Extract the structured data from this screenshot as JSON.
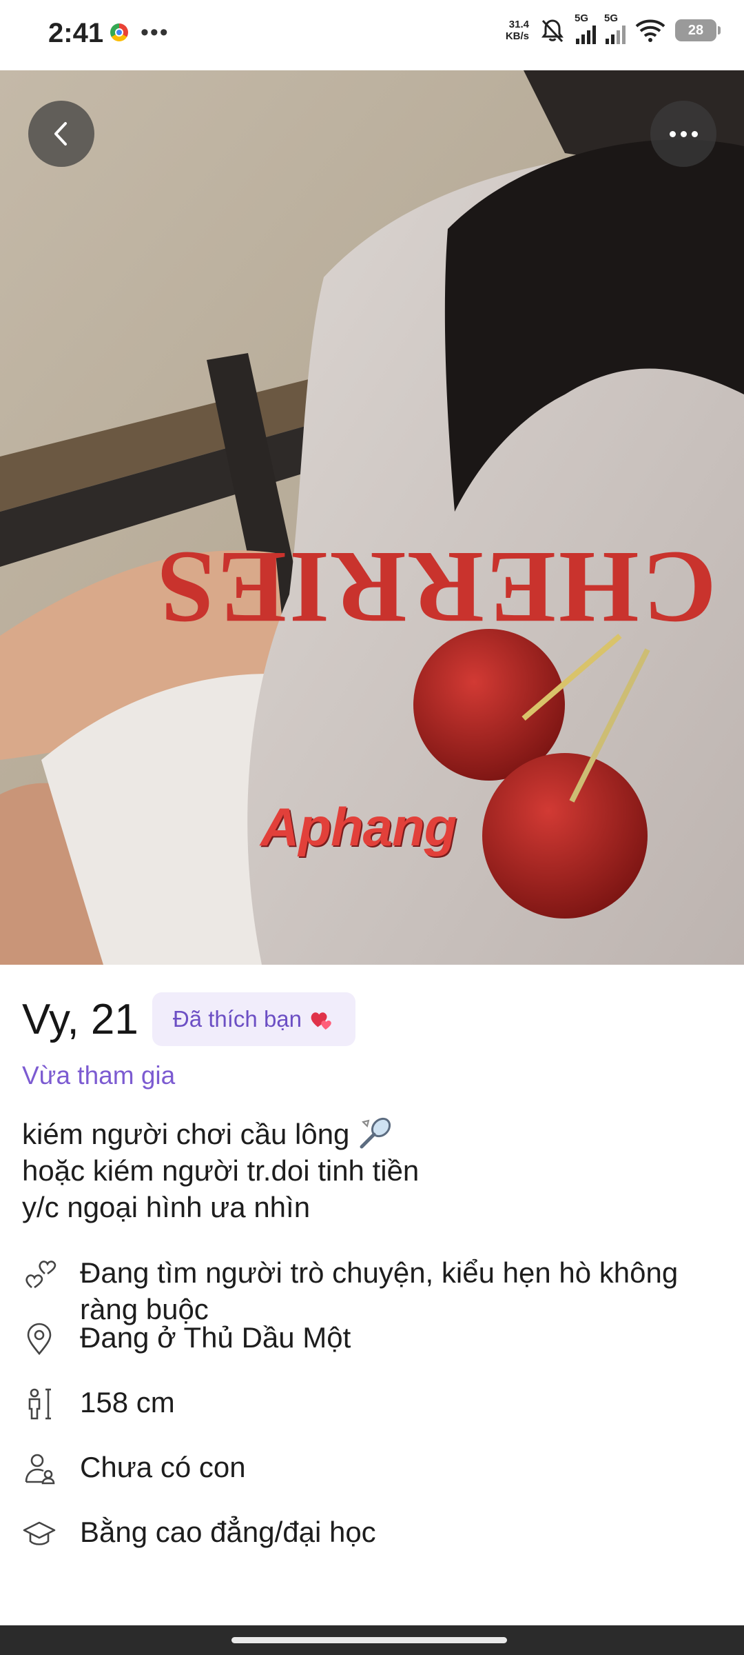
{
  "status_bar": {
    "time": "2:41",
    "net_speed_value": "31.4",
    "net_speed_unit": "KB/s",
    "signal1_label": "5G",
    "signal2_label": "5G",
    "battery": "28"
  },
  "photo": {
    "watermark": "Aphang",
    "shirt_text": "CHERRIES"
  },
  "profile": {
    "name_age": "Vy, 21",
    "liked_badge": "Đã thích bạn",
    "joined_status": "Vừa tham gia",
    "bio": [
      "kiém người chơi cầu lông",
      "hoặc kiém người tr.doi tinh tiền",
      "y/c ngoại hình ưa nhìn"
    ],
    "details": [
      {
        "icon": "hearts-icon",
        "text": "Đang tìm người trò chuyện, kiểu hẹn hò không ràng buộc"
      },
      {
        "icon": "location-pin-icon",
        "text": "Đang ở Thủ Dầu Một"
      },
      {
        "icon": "height-icon",
        "text": "158 cm"
      },
      {
        "icon": "children-icon",
        "text": "Chưa có con"
      },
      {
        "icon": "graduation-cap-icon",
        "text": "Bằng cao đẳng/đại học"
      }
    ]
  },
  "colors": {
    "accent_purple": "#7c5bd1",
    "badge_bg": "#f1edfb"
  }
}
